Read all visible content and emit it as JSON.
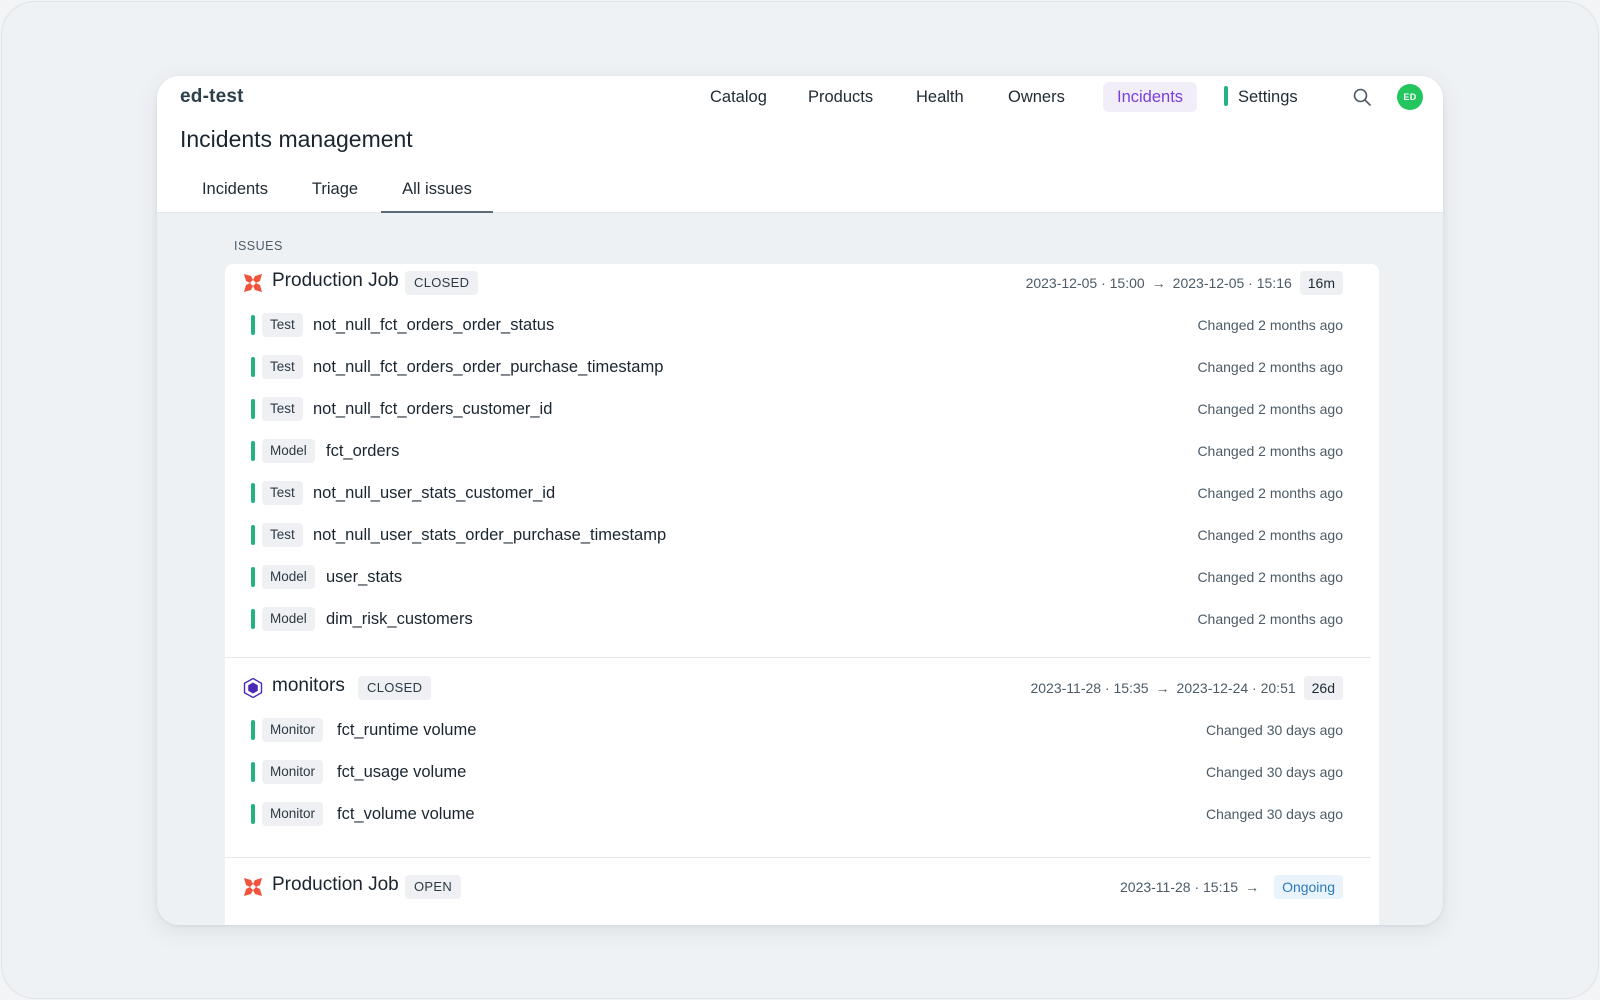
{
  "app": {
    "brand": "ed-test"
  },
  "nav": {
    "items": [
      "Catalog",
      "Products",
      "Health",
      "Owners",
      "Incidents",
      "Settings"
    ],
    "active": "Incidents",
    "user_initials": "ED"
  },
  "page": {
    "title": "Incidents management",
    "tabs": [
      "Incidents",
      "Triage",
      "All issues"
    ],
    "active_tab": "All issues",
    "section_label": "ISSUES"
  },
  "groups": [
    {
      "name": "Production Job",
      "icon": "production-job-icon",
      "status": "CLOSED",
      "start": "2023-12-05 · 15:00",
      "end": "2023-12-05 · 15:16",
      "duration": "16m",
      "rows": [
        {
          "type": "Test",
          "name": "not_null_fct_orders_order_status",
          "changed": "Changed 2 months ago"
        },
        {
          "type": "Test",
          "name": "not_null_fct_orders_order_purchase_timestamp",
          "changed": "Changed 2 months ago"
        },
        {
          "type": "Test",
          "name": "not_null_fct_orders_customer_id",
          "changed": "Changed 2 months ago"
        },
        {
          "type": "Model",
          "name": "fct_orders",
          "changed": "Changed 2 months ago"
        },
        {
          "type": "Test",
          "name": "not_null_user_stats_customer_id",
          "changed": "Changed 2 months ago"
        },
        {
          "type": "Test",
          "name": "not_null_user_stats_order_purchase_timestamp",
          "changed": "Changed 2 months ago"
        },
        {
          "type": "Model",
          "name": "user_stats",
          "changed": "Changed 2 months ago"
        },
        {
          "type": "Model",
          "name": "dim_risk_customers",
          "changed": "Changed 2 months ago"
        }
      ]
    },
    {
      "name": "monitors",
      "icon": "monitor-hexagon-icon",
      "status": "CLOSED",
      "start": "2023-11-28 · 15:35",
      "end": "2023-12-24 · 20:51",
      "duration": "26d",
      "rows": [
        {
          "type": "Monitor",
          "name": "fct_runtime volume",
          "changed": "Changed 30 days ago"
        },
        {
          "type": "Monitor",
          "name": "fct_usage volume",
          "changed": "Changed 30 days ago"
        },
        {
          "type": "Monitor",
          "name": "fct_volume volume",
          "changed": "Changed 30 days ago"
        }
      ]
    },
    {
      "name": "Production Job",
      "icon": "production-job-icon",
      "status": "OPEN",
      "start": "2023-11-28 · 15:15",
      "end": "",
      "duration": "Ongoing",
      "rows": []
    }
  ],
  "colors": {
    "accent": "#7c3fd9",
    "status_bar": "#22b37e",
    "avatar": "#22c55e",
    "ongoing": "#2a7bbf",
    "job_icon": "#f0543c",
    "monitor_icon": "#4b2bb5"
  }
}
